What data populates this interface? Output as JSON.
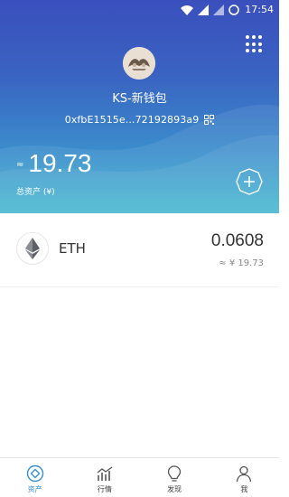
{
  "status_bar": {
    "time": "17:54"
  },
  "wallet": {
    "name": "KS-新钱包",
    "address": "0xfbE1515e...72192893a9",
    "approx_symbol": "≈",
    "total_balance": "19.73",
    "total_label": "总资产 (¥)"
  },
  "assets": [
    {
      "symbol": "ETH",
      "amount": "0.0608",
      "value": "≈ ¥ 19.73"
    }
  ],
  "tabs": [
    {
      "label": "资产",
      "icon": "asset-icon",
      "active": true
    },
    {
      "label": "行情",
      "icon": "market-icon",
      "active": false
    },
    {
      "label": "发现",
      "icon": "discover-icon",
      "active": false
    },
    {
      "label": "我",
      "icon": "profile-icon",
      "active": false
    }
  ],
  "colors": {
    "header_top": "#3a4fbd",
    "header_bottom": "#3fb7cf",
    "accent": "#3a8fd0",
    "text_dark": "#333333",
    "text_muted": "#888888"
  }
}
